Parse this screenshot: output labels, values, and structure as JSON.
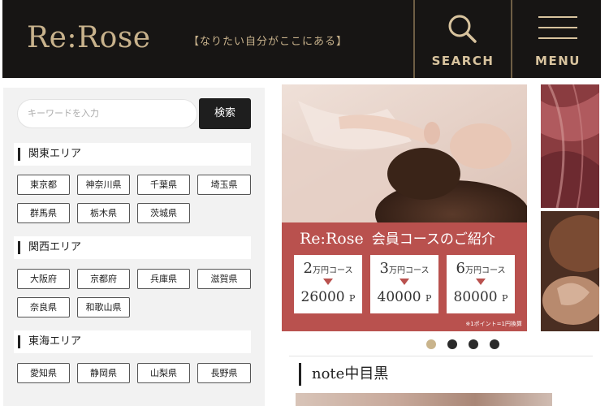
{
  "header": {
    "logo": "Re:Rose",
    "tagline": "【なりたい自分がここにある】",
    "search_label": "SEARCH",
    "menu_label": "MENU"
  },
  "sidebar": {
    "search": {
      "placeholder": "キーワードを入力",
      "button": "検索"
    },
    "regions": [
      {
        "name": "関東エリア",
        "prefectures": [
          "東京都",
          "神奈川県",
          "千葉県",
          "埼玉県",
          "群馬県",
          "栃木県",
          "茨城県"
        ]
      },
      {
        "name": "関西エリア",
        "prefectures": [
          "大阪府",
          "京都府",
          "兵庫県",
          "滋賀県",
          "奈良県",
          "和歌山県"
        ]
      },
      {
        "name": "東海エリア",
        "prefectures": [
          "愛知県",
          "静岡県",
          "山梨県",
          "長野県"
        ]
      }
    ]
  },
  "banner": {
    "brand": "Re:Rose",
    "title": "会員コースのご紹介",
    "plans": [
      {
        "num": "2",
        "unit": "万円コース",
        "points": "26000",
        "suffix": "P"
      },
      {
        "num": "3",
        "unit": "万円コース",
        "points": "40000",
        "suffix": "P"
      },
      {
        "num": "6",
        "unit": "万円コース",
        "points": "80000",
        "suffix": "P"
      }
    ],
    "note": "※1ポイント=1円換算"
  },
  "carousel": {
    "slides": 4,
    "active": 1
  },
  "section": {
    "title": "note中目黒"
  },
  "colors": {
    "header_bg": "#171514",
    "gold": "#c8b28c",
    "banner_red": "#b9514e",
    "dot_active": "#c9b48c"
  }
}
